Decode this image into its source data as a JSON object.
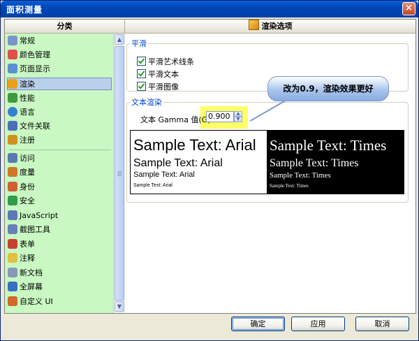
{
  "window": {
    "title": "面积测量"
  },
  "header": {
    "left": "分类",
    "right": "渲染选项"
  },
  "sidebar": {
    "items": [
      {
        "label": "常规",
        "color": "#7B95C9"
      },
      {
        "label": "颜色管理",
        "color": "#E0504A"
      },
      {
        "label": "页面显示",
        "color": "#5A8FD0"
      },
      {
        "label": "渲染",
        "color": "#E8A020"
      },
      {
        "label": "性能",
        "color": "#3E9A3E"
      },
      {
        "label": "语言",
        "color": "#3480D0"
      },
      {
        "label": "文件关联",
        "color": "#4A70B8"
      },
      {
        "label": "注册",
        "color": "#D09020"
      },
      {
        "label": "访问",
        "color": "#5A78B0"
      },
      {
        "label": "度量",
        "color": "#D07828"
      },
      {
        "label": "身份",
        "color": "#D06030"
      },
      {
        "label": "安全",
        "color": "#2E9E4A"
      },
      {
        "label": "JavaScript",
        "color": "#5A7AB8"
      },
      {
        "label": "截图工具",
        "color": "#6880B8"
      },
      {
        "label": "表单",
        "color": "#C84030"
      },
      {
        "label": "注释",
        "color": "#E0C040"
      },
      {
        "label": "新文档",
        "color": "#8898B8"
      },
      {
        "label": "全屏幕",
        "color": "#3870C0"
      },
      {
        "label": "自定义 UI",
        "color": "#D06828"
      }
    ],
    "selected": 3
  },
  "smoothing": {
    "legend": "平滑",
    "options": [
      {
        "label": "平滑艺术线条",
        "checked": true
      },
      {
        "label": "平滑文本",
        "checked": true
      },
      {
        "label": "平滑图像",
        "checked": true
      }
    ]
  },
  "text_render": {
    "legend": "文本渲染",
    "gamma_label": "文本 Gamma 值(G):",
    "gamma_value": "0.900"
  },
  "callout": {
    "text": "改为0.9，渲染效果更好"
  },
  "samples": {
    "arial": "Sample Text: Arial",
    "times": "Sample Text: Times"
  },
  "buttons": {
    "ok": "确定",
    "apply": "应用",
    "cancel": "取消"
  }
}
